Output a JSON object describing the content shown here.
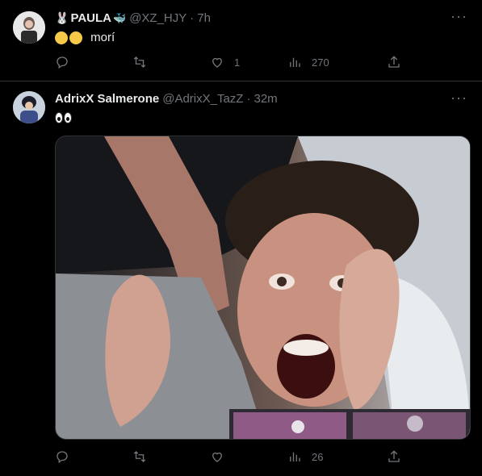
{
  "tweets": [
    {
      "name": "PAULA",
      "handle": "@XZ_HJY",
      "time": "7h",
      "text": "morí",
      "actions": {
        "reply": "",
        "retweet": "",
        "like": "1",
        "views": "270"
      }
    },
    {
      "name": "AdrixX Salmerone",
      "handle": "@AdrixX_TazZ",
      "time": "32m",
      "actions": {
        "reply": "",
        "retweet": "",
        "like": "",
        "views": "26"
      }
    }
  ],
  "colors": {
    "background": "#000000",
    "text": "#e7e9ea",
    "muted": "#71767b",
    "divider": "#2f3336"
  }
}
